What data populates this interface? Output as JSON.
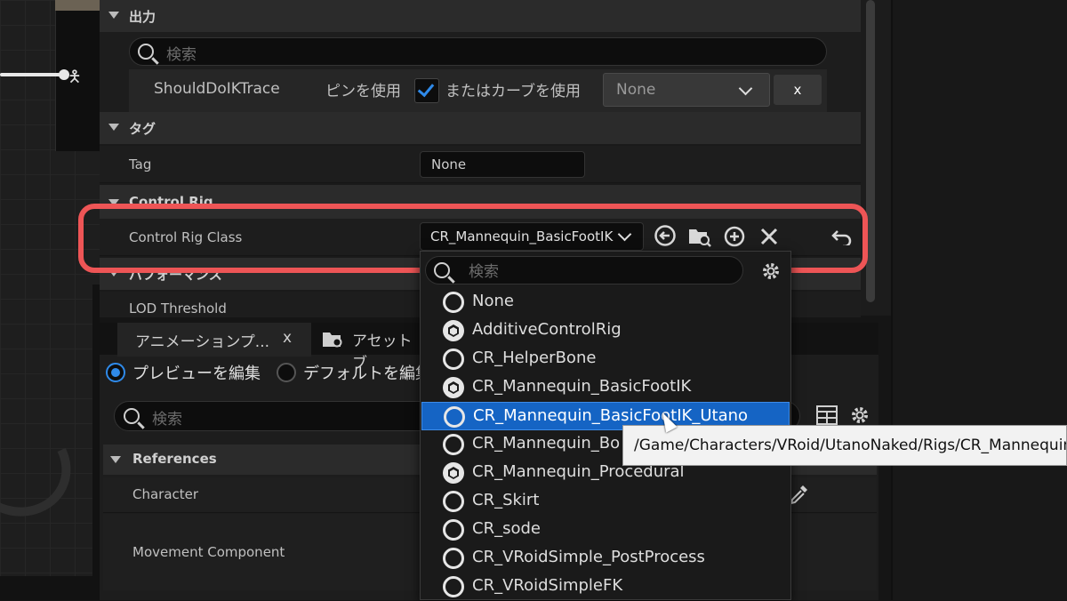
{
  "details": {
    "output": {
      "category": "出力",
      "search_placeholder": "検索",
      "property": "ShouldDoIKTrace",
      "use_pin_label": "ピンを使用",
      "or_curve_label": "またはカーブを使用",
      "curve_value": "None",
      "clear_label": "x",
      "use_pin_checked": true
    },
    "tag": {
      "category": "タグ",
      "label": "Tag",
      "value": "None"
    },
    "control_rig": {
      "category": "Control Rig",
      "label": "Control Rig Class",
      "value": "CR_Mannequin_BasicFootIK"
    },
    "performance": {
      "category": "パフォーマンス",
      "lod_label": "LOD Threshold"
    }
  },
  "bottom_panel": {
    "tabs": [
      {
        "label": "アニメーションプ...",
        "close": "x"
      },
      {
        "label": "アセットブ"
      }
    ],
    "radio_preview": "プレビューを編集",
    "radio_default": "デフォルトを編集",
    "search_placeholder": "検索",
    "references_category": "References",
    "character_label": "Character",
    "movement_label": "Movement Component"
  },
  "dropdown": {
    "search_placeholder": "検索",
    "items": [
      {
        "name": "None",
        "icon": "ring"
      },
      {
        "name": "AdditiveControlRig",
        "icon": "cube"
      },
      {
        "name": "CR_HelperBone",
        "icon": "ring"
      },
      {
        "name": "CR_Mannequin_BasicFootIK",
        "icon": "cube"
      },
      {
        "name": "CR_Mannequin_BasicFootIK_Utano",
        "icon": "ring",
        "selected": true
      },
      {
        "name": "CR_Mannequin_Bo",
        "icon": "ring"
      },
      {
        "name": "CR_Mannequin_Procedural",
        "icon": "cube"
      },
      {
        "name": "CR_Skirt",
        "icon": "ring"
      },
      {
        "name": "CR_sode",
        "icon": "ring"
      },
      {
        "name": "CR_VRoidSimple_PostProcess",
        "icon": "ring"
      },
      {
        "name": "CR_VRoidSimpleFK",
        "icon": "ring"
      }
    ]
  },
  "tooltip": "/Game/Characters/VRoid/UtanoNaked/Rigs/CR_Mannequin_BasicFootIK_Utano",
  "highlight_color": "#ee5556",
  "accent_color": "#2f8ae9"
}
